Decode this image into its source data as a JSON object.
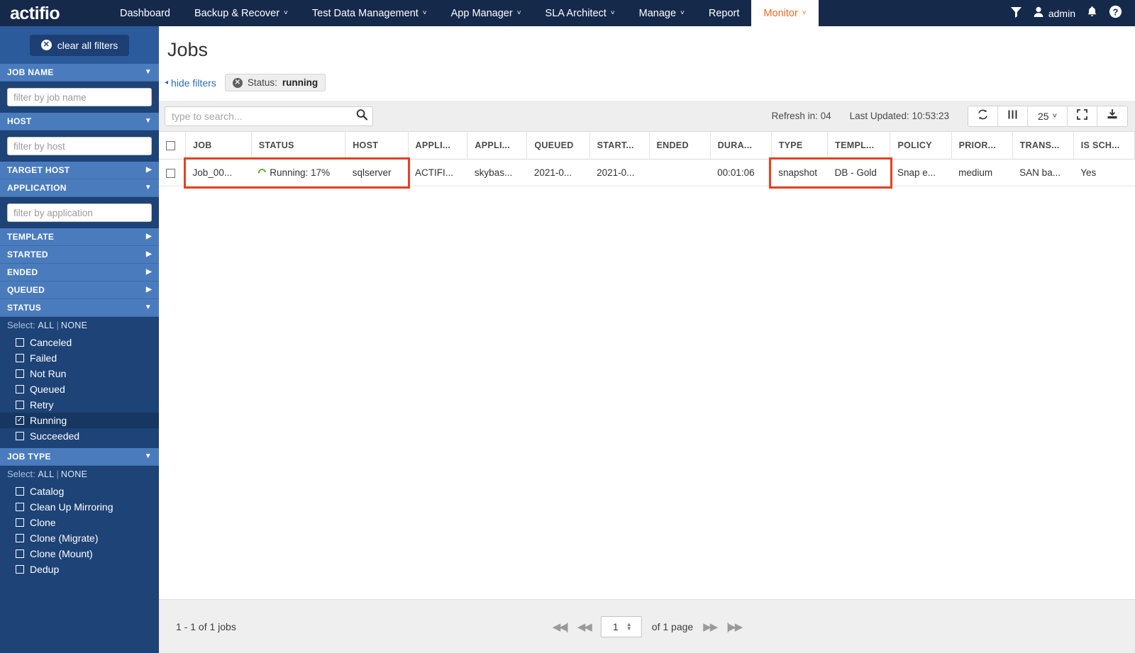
{
  "brand": {
    "logo_text": "actifio"
  },
  "topnav": {
    "items": [
      {
        "label": "Dashboard",
        "caret": false,
        "active": false
      },
      {
        "label": "Backup & Recover",
        "caret": true,
        "active": false
      },
      {
        "label": "Test Data Management",
        "caret": true,
        "active": false
      },
      {
        "label": "App Manager",
        "caret": true,
        "active": false
      },
      {
        "label": "SLA Architect",
        "caret": true,
        "active": false
      },
      {
        "label": "Manage",
        "caret": true,
        "active": false
      },
      {
        "label": "Report",
        "caret": false,
        "active": false
      },
      {
        "label": "Monitor",
        "caret": true,
        "active": true
      }
    ],
    "caret_glyph": "˅",
    "right": {
      "filter_icon": "filter-funnel-icon",
      "user_icon": "user-icon",
      "username": "admin",
      "bell_icon": "bell-icon",
      "help_icon": "help-circle-icon"
    },
    "accent_active_color": "#f26722",
    "bar_color": "#15294b"
  },
  "sidebar": {
    "clear_all_filters_label": "clear all filters",
    "sections": [
      {
        "title": "JOB NAME",
        "expanded": true,
        "body": "input",
        "placeholder": "filter by job name",
        "value": ""
      },
      {
        "title": "HOST",
        "expanded": true,
        "body": "input",
        "placeholder": "filter by host",
        "value": ""
      },
      {
        "title": "TARGET HOST",
        "expanded": false,
        "body": "none"
      },
      {
        "title": "APPLICATION",
        "expanded": true,
        "body": "input",
        "placeholder": "filter by application",
        "value": ""
      },
      {
        "title": "TEMPLATE",
        "expanded": false,
        "body": "none"
      },
      {
        "title": "STARTED",
        "expanded": false,
        "body": "none"
      },
      {
        "title": "ENDED",
        "expanded": false,
        "body": "none"
      },
      {
        "title": "QUEUED",
        "expanded": false,
        "body": "none"
      },
      {
        "title": "STATUS",
        "expanded": true,
        "body": "checkboxes",
        "select_label": "Select:",
        "select_all": "ALL",
        "select_none": "NONE",
        "options": [
          {
            "label": "Canceled",
            "checked": false
          },
          {
            "label": "Failed",
            "checked": false
          },
          {
            "label": "Not Run",
            "checked": false
          },
          {
            "label": "Queued",
            "checked": false
          },
          {
            "label": "Retry",
            "checked": false
          },
          {
            "label": "Running",
            "checked": true
          },
          {
            "label": "Succeeded",
            "checked": false
          }
        ]
      },
      {
        "title": "JOB TYPE",
        "expanded": true,
        "body": "checkboxes",
        "select_label": "Select:",
        "select_all": "ALL",
        "select_none": "NONE",
        "options": [
          {
            "label": "Catalog",
            "checked": false
          },
          {
            "label": "Clean Up Mirroring",
            "checked": false
          },
          {
            "label": "Clone",
            "checked": false
          },
          {
            "label": "Clone (Migrate)",
            "checked": false
          },
          {
            "label": "Clone (Mount)",
            "checked": false
          },
          {
            "label": "Dedup",
            "checked": false
          }
        ]
      }
    ],
    "tri_expanded": "▼",
    "tri_collapsed": "▶",
    "check_glyph": "✓"
  },
  "main": {
    "page_title": "Jobs",
    "hide_filters_label": "hide filters",
    "hide_filters_arrow": "◂",
    "active_filter_chip": {
      "key": "Status:",
      "value": "running"
    },
    "search": {
      "placeholder": "type to search...",
      "value": ""
    },
    "toolbar": {
      "refresh_in": "Refresh in: 04",
      "last_updated": "Last Updated: 10:53:23",
      "refresh_icon": "refresh-icon",
      "columns_icon": "columns-icon",
      "page_size": "25",
      "page_size_caret": "˅",
      "fullscreen_icon": "fullscreen-icon",
      "download_icon": "download-icon"
    },
    "table": {
      "columns": [
        "JOB",
        "STATUS",
        "HOST",
        "APPLI...",
        "APPLI...",
        "QUEUED",
        "START...",
        "ENDED",
        "DURA...",
        "TYPE",
        "TEMPL...",
        "POLICY",
        "PRIOR...",
        "TRANS...",
        "IS SCH..."
      ],
      "rows": [
        {
          "job": "Job_00...",
          "status": "Running: 17%",
          "status_icon": "spinner-icon",
          "host": "sqlserver",
          "appli1": "ACTIFI...",
          "appli2": "skybas...",
          "queued": "2021-0...",
          "started": "2021-0...",
          "ended": "",
          "duration": "00:01:06",
          "type": "snapshot",
          "template": "DB - Gold",
          "policy": "Snap e...",
          "priority": "medium",
          "transport": "SAN ba...",
          "is_scheduled": "Yes"
        }
      ]
    },
    "footer": {
      "job_count": "1 - 1 of 1 jobs",
      "first_icon": "first-page-icon",
      "prev_icon": "prev-page-icon",
      "page_value": "1",
      "of_pages": "of 1 page",
      "next_icon": "next-page-icon",
      "last_icon": "last-page-icon"
    }
  },
  "annotations": {
    "highlight_color": "#e8401f",
    "boxes": [
      {
        "name": "job-status-host-highlight"
      },
      {
        "name": "type-template-highlight"
      }
    ]
  }
}
